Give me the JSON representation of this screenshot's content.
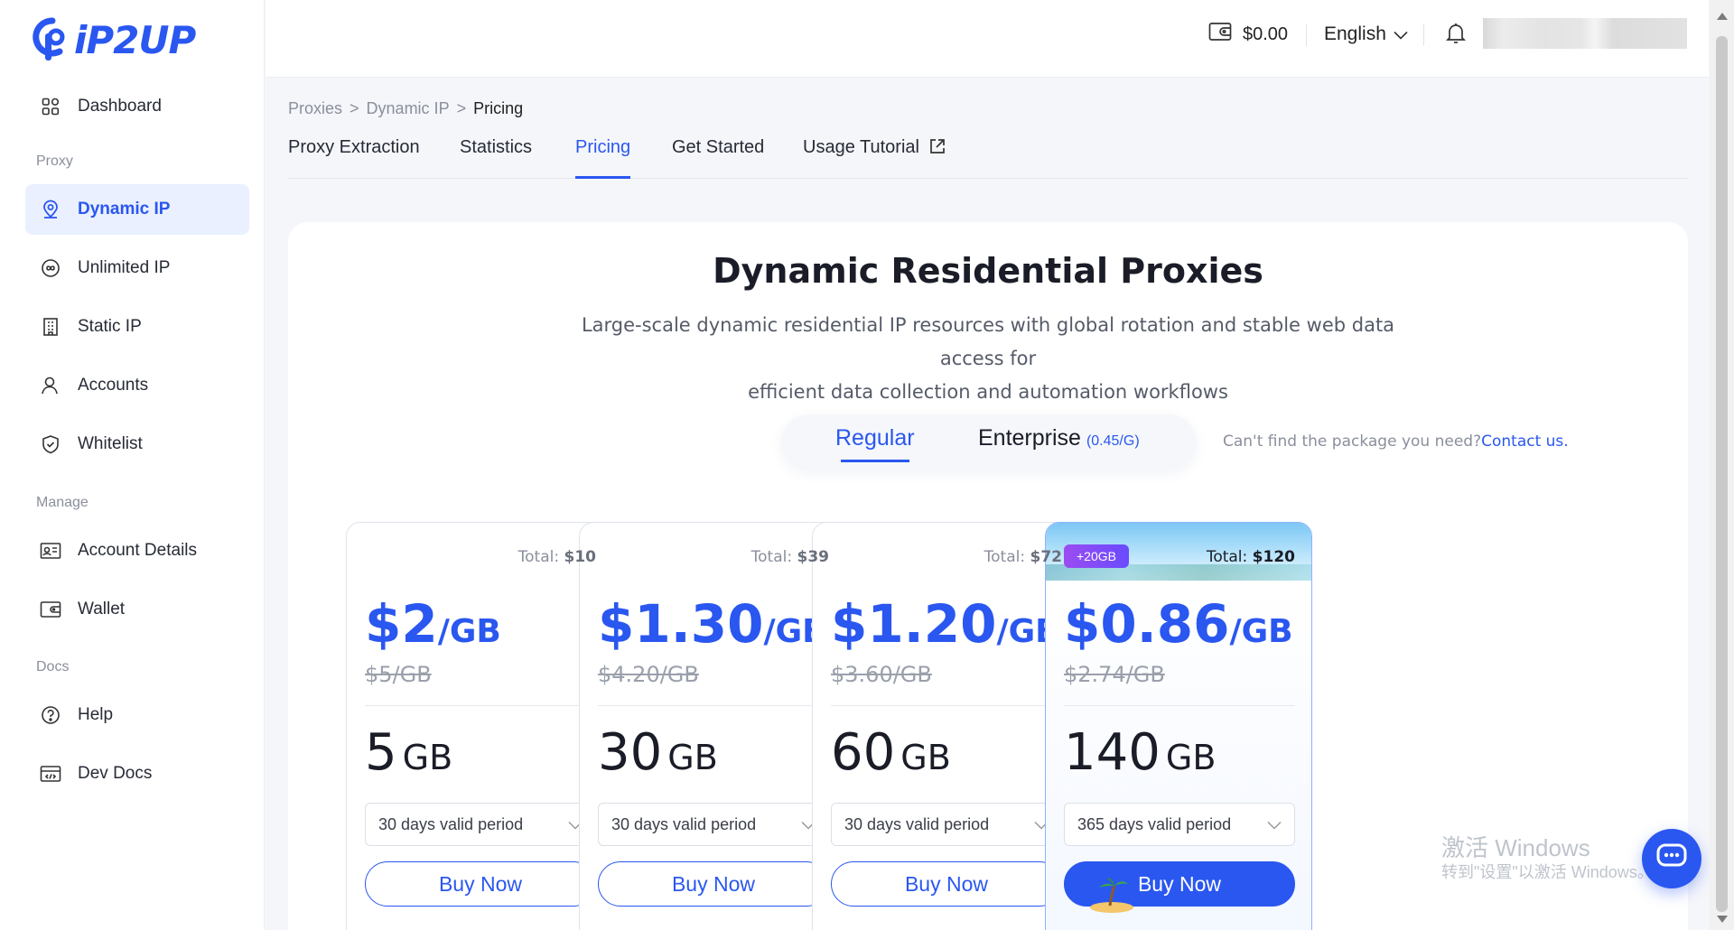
{
  "brand": {
    "name": "iP2UP",
    "color": "#2a57f0"
  },
  "sidebar": {
    "top_item": {
      "label": "Dashboard",
      "icon": "grid-icon"
    },
    "sections": [
      {
        "title": "Proxy"
      },
      {
        "title": "Manage"
      },
      {
        "title": "Docs"
      }
    ],
    "items": [
      {
        "label": "Dynamic IP",
        "icon": "location-pin-icon",
        "active": true
      },
      {
        "label": "Unlimited IP",
        "icon": "infinity-icon"
      },
      {
        "label": "Static IP",
        "icon": "building-icon"
      },
      {
        "label": "Accounts",
        "icon": "user-icon"
      },
      {
        "label": "Whitelist",
        "icon": "shield-icon"
      },
      {
        "label": "Account Details",
        "icon": "id-card-icon"
      },
      {
        "label": "Wallet",
        "icon": "wallet-icon"
      },
      {
        "label": "Help",
        "icon": "help-circle-icon"
      },
      {
        "label": "Dev Docs",
        "icon": "code-icon"
      }
    ]
  },
  "topbar": {
    "balance": "$0.00",
    "language": "English"
  },
  "breadcrumb": [
    "Proxies",
    ">",
    "Dynamic IP",
    ">",
    "Pricing"
  ],
  "tabs": [
    {
      "label": "Proxy Extraction"
    },
    {
      "label": "Statistics"
    },
    {
      "label": "Pricing",
      "active": true
    },
    {
      "label": "Get Started"
    },
    {
      "label": "Usage Tutorial",
      "external": true
    }
  ],
  "main": {
    "title": "Dynamic Residential Proxies",
    "subtitle_line1": "Large-scale dynamic residential IP resources with global rotation and stable web data access for",
    "subtitle_line2": "efficient data collection and automation workflows",
    "switch": {
      "regular": "Regular",
      "enterprise": "Enterprise",
      "enterprise_note": "(0.45/G)",
      "selected": "Regular"
    },
    "help_text": "Can't find the package you need?",
    "help_link": "Contact us."
  },
  "plans": [
    {
      "total_label": "Total:",
      "total": "$10",
      "price": "$2",
      "unit": "/GB",
      "original": "$5/GB",
      "size": "5",
      "size_unit": "GB",
      "period": "30 days valid period",
      "cta": "Buy Now"
    },
    {
      "total_label": "Total:",
      "total": "$39",
      "price": "$1.30",
      "unit": "/GB",
      "original": "$4.20/GB",
      "size": "30",
      "size_unit": "GB",
      "period": "30 days valid period",
      "cta": "Buy Now"
    },
    {
      "total_label": "Total:",
      "total": "$72",
      "price": "$1.20",
      "unit": "/GB",
      "original": "$3.60/GB",
      "size": "60",
      "size_unit": "GB",
      "period": "30 days valid period",
      "cta": "Buy Now"
    },
    {
      "total_label": "Total:",
      "total": "$120",
      "price": "$0.86",
      "unit": "/GB",
      "original": "$2.74/GB",
      "size": "140",
      "size_unit": "GB",
      "period": "365 days valid period",
      "cta": "Buy Now",
      "badge": "+20GB",
      "featured": true
    }
  ],
  "watermark": {
    "line1": "激活 Windows",
    "line2": "转到\"设置\"以激活 Windows。"
  },
  "floating": {
    "chat_icon": "chat-bubble-icon"
  }
}
